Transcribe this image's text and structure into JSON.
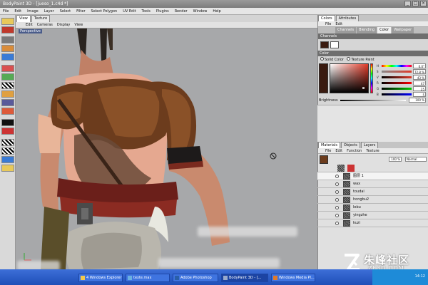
{
  "window": {
    "title": "BodyPaint 3D - [jueso_1.c4d *]",
    "controls": [
      "_",
      "□",
      "×"
    ]
  },
  "menu": [
    "File",
    "Edit",
    "Image",
    "Layer",
    "Select",
    "Filter",
    "Select Polygon",
    "UV Edit",
    "Tools",
    "Plugins",
    "Render",
    "Window",
    "Help"
  ],
  "viewport": {
    "tabs": [
      "View",
      "Texture"
    ],
    "menu": [
      "Edit",
      "Cameras",
      "Display",
      "View"
    ],
    "label": "Perspective"
  },
  "colors_panel": {
    "tabs": [
      "Colors",
      "Attributes"
    ],
    "menu": [
      "File",
      "Edit"
    ],
    "subtabs": [
      "Channels",
      "Blending",
      "Color",
      "Wallpaper"
    ],
    "active_subtab": "Color",
    "channels_header": "Channels",
    "color_header": "Color",
    "mode_options": [
      "Solid Color",
      "Texture Paint"
    ],
    "brightness_label": "Brightness",
    "brightness_value": "100 %",
    "sliders": [
      {
        "label": "H",
        "value": "0.0°"
      },
      {
        "label": "S",
        "value": "72.8 %"
      },
      {
        "label": "V",
        "value": "43 %"
      },
      {
        "label": "R",
        "value": "47"
      },
      {
        "label": "G",
        "value": "25"
      },
      {
        "label": "B",
        "value": "5"
      }
    ],
    "current_color": "#3a1b10",
    "accent": "#e03a28"
  },
  "layers_panel": {
    "tabs": [
      "Materials",
      "Objects",
      "Layers"
    ],
    "menu": [
      "File",
      "Edit",
      "Function",
      "Texture"
    ],
    "opacity": "100 %",
    "blend_mode": "Normal",
    "layers": [
      "图层 1",
      "wax",
      "toudai",
      "hongbu2",
      "lebu",
      "yingzhe",
      "kuzi"
    ]
  },
  "taskbar": {
    "items": [
      "4 Windows Explorer",
      "texte.max",
      "Adobe Photoshop",
      "BodyPaint 3D - [...",
      "Windows Media Pl..."
    ],
    "clock": "14:12"
  },
  "watermark": {
    "title": "朱峰社区",
    "subtitle": "ZF3D.COM"
  }
}
